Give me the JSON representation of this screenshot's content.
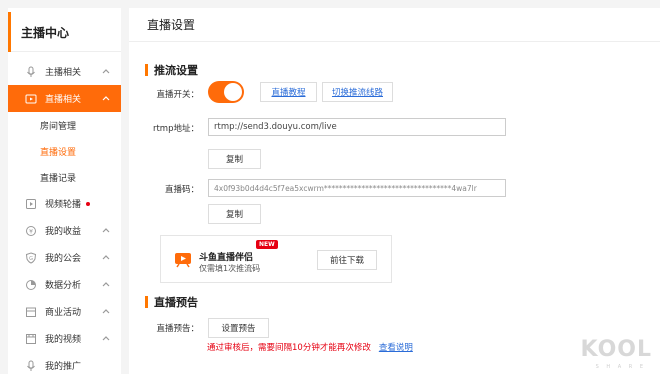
{
  "sidebar": {
    "title": "主播中心",
    "items": [
      {
        "label": "主播相关",
        "icon": "mic-icon",
        "chevron": "up"
      },
      {
        "label": "直播相关",
        "icon": "video-icon",
        "chevron": "up",
        "active": true
      },
      {
        "label": "视频轮播",
        "icon": "carousel-icon",
        "dot": true
      },
      {
        "label": "我的收益",
        "icon": "coin-icon",
        "chevron": "up"
      },
      {
        "label": "我的公会",
        "icon": "shield-icon",
        "chevron": "up"
      },
      {
        "label": "数据分析",
        "icon": "pie-chart-icon",
        "chevron": "up"
      },
      {
        "label": "商业活动",
        "icon": "shop-icon",
        "chevron": "up"
      },
      {
        "label": "我的视频",
        "icon": "film-icon",
        "chevron": "up"
      },
      {
        "label": "我的推广",
        "icon": "mic-icon"
      }
    ],
    "subitems": [
      {
        "label": "房间管理"
      },
      {
        "label": "直播设置",
        "current": true
      },
      {
        "label": "直播记录"
      }
    ]
  },
  "main": {
    "page_title": "直播设置",
    "stream_section": {
      "title": "推流设置",
      "switch_label": "直播开关：",
      "switch_on": true,
      "tutorial_link": "直播教程",
      "switch_line_link": "切换推流线路",
      "rtmp_label": "rtmp地址：",
      "rtmp_value": "rtmp://send3.douyu.com/live",
      "copy_label": "复制",
      "code_label": "直播码：",
      "code_value": "4x0f93b0d4d4c5f7ea5xcwrm**********************************4wa7lr",
      "copy2_label": "复制"
    },
    "companion": {
      "name": "斗鱼直播伴侣",
      "badge": "NEW",
      "desc": "仅需填1次推流码",
      "download_label": "前往下载"
    },
    "preview_section": {
      "title": "直播预告",
      "label": "直播预告：",
      "set_button": "设置预告",
      "hint": "通过审核后，需要间隔10分钟才能再次修改",
      "hint_link": "查看说明"
    }
  },
  "watermark": {
    "text": "KOOL",
    "sub": "S H A R E"
  },
  "colors": {
    "accent": "#ff6b0a",
    "link": "#2b6cd8",
    "warning": "#e60012"
  }
}
